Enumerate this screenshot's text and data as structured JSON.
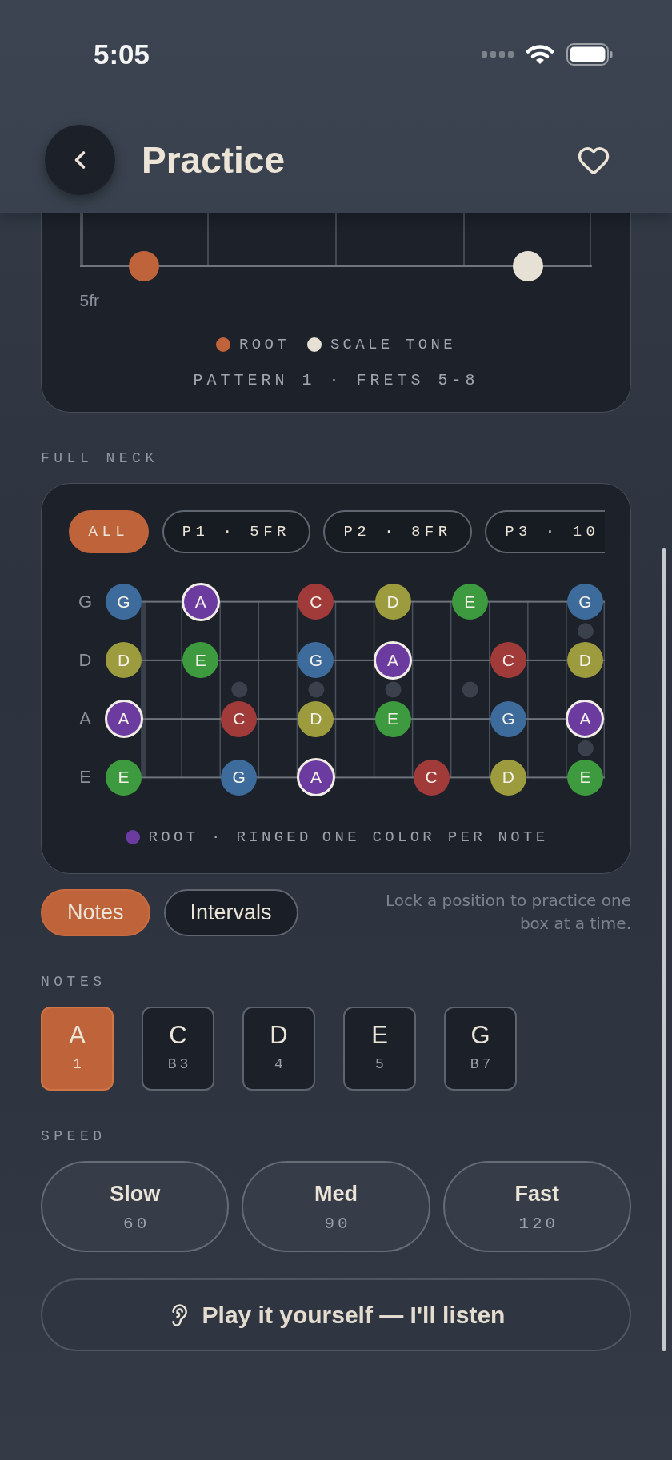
{
  "status_bar": {
    "time": "5:05"
  },
  "header": {
    "title": "Practice",
    "favorite": false
  },
  "pattern_card": {
    "slots": [
      {
        "kind": "root"
      },
      {
        "kind": "empty"
      },
      {
        "kind": "empty"
      },
      {
        "kind": "scale_tone"
      }
    ],
    "fret_label": "5fr",
    "legend": [
      {
        "kind": "root",
        "label": "ROOT"
      },
      {
        "kind": "scale_tone",
        "label": "SCALE TONE"
      }
    ],
    "caption": "PATTERN 1 · FRETS 5-8"
  },
  "full_neck": {
    "heading": "FULL NECK",
    "positions": [
      {
        "label": "ALL",
        "selected": true
      },
      {
        "label": "P1 · 5FR",
        "selected": false
      },
      {
        "label": "P2 · 8FR",
        "selected": false
      },
      {
        "label": "P3 · 10",
        "selected": false
      }
    ],
    "strings": [
      {
        "name": "G",
        "slots": [
          {
            "kind": "note",
            "label": "G",
            "color": "#3c6b9c",
            "root": false
          },
          {
            "kind": "empty"
          },
          {
            "kind": "note",
            "label": "A",
            "color": "#6b3ba0",
            "root": true
          },
          {
            "kind": "empty"
          },
          {
            "kind": "empty"
          },
          {
            "kind": "note",
            "label": "C",
            "color": "#a13b39",
            "root": false
          },
          {
            "kind": "empty"
          },
          {
            "kind": "note",
            "label": "D",
            "color": "#9c9b3d",
            "root": false
          },
          {
            "kind": "empty"
          },
          {
            "kind": "note",
            "label": "E",
            "color": "#3e9a3e",
            "root": false
          },
          {
            "kind": "empty"
          },
          {
            "kind": "empty"
          },
          {
            "kind": "note",
            "label": "G",
            "color": "#3c6b9c",
            "root": false
          }
        ]
      },
      {
        "name": "D",
        "slots": [
          {
            "kind": "note",
            "label": "D",
            "color": "#9c9b3d",
            "root": false
          },
          {
            "kind": "empty"
          },
          {
            "kind": "note",
            "label": "E",
            "color": "#3e9a3e",
            "root": false
          },
          {
            "kind": "empty"
          },
          {
            "kind": "empty"
          },
          {
            "kind": "note",
            "label": "G",
            "color": "#3c6b9c",
            "root": false
          },
          {
            "kind": "empty"
          },
          {
            "kind": "note",
            "label": "A",
            "color": "#6b3ba0",
            "root": true
          },
          {
            "kind": "empty"
          },
          {
            "kind": "empty"
          },
          {
            "kind": "note",
            "label": "C",
            "color": "#a13b39",
            "root": false
          },
          {
            "kind": "empty"
          },
          {
            "kind": "note",
            "label": "D",
            "color": "#9c9b3d",
            "root": false
          }
        ]
      },
      {
        "name": "A",
        "slots": [
          {
            "kind": "note",
            "label": "A",
            "color": "#6b3ba0",
            "root": true
          },
          {
            "kind": "empty"
          },
          {
            "kind": "empty"
          },
          {
            "kind": "note",
            "label": "C",
            "color": "#a13b39",
            "root": false
          },
          {
            "kind": "empty"
          },
          {
            "kind": "note",
            "label": "D",
            "color": "#9c9b3d",
            "root": false
          },
          {
            "kind": "empty"
          },
          {
            "kind": "note",
            "label": "E",
            "color": "#3e9a3e",
            "root": false
          },
          {
            "kind": "empty"
          },
          {
            "kind": "empty"
          },
          {
            "kind": "note",
            "label": "G",
            "color": "#3c6b9c",
            "root": false
          },
          {
            "kind": "empty"
          },
          {
            "kind": "note",
            "label": "A",
            "color": "#6b3ba0",
            "root": true
          }
        ]
      },
      {
        "name": "E",
        "slots": [
          {
            "kind": "note",
            "label": "E",
            "color": "#3e9a3e",
            "root": false
          },
          {
            "kind": "empty"
          },
          {
            "kind": "empty"
          },
          {
            "kind": "note",
            "label": "G",
            "color": "#3c6b9c",
            "root": false
          },
          {
            "kind": "empty"
          },
          {
            "kind": "note",
            "label": "A",
            "color": "#6b3ba0",
            "root": true
          },
          {
            "kind": "empty"
          },
          {
            "kind": "empty"
          },
          {
            "kind": "note",
            "label": "C",
            "color": "#a13b39",
            "root": false
          },
          {
            "kind": "empty"
          },
          {
            "kind": "note",
            "label": "D",
            "color": "#9c9b3d",
            "root": false
          },
          {
            "kind": "empty"
          },
          {
            "kind": "note",
            "label": "E",
            "color": "#3e9a3e",
            "root": false
          }
        ]
      }
    ],
    "legend": {
      "color": "#6b3ba0",
      "label": "ROOT · RINGED",
      "note": "ONE COLOR PER NOTE"
    }
  },
  "display_modes": [
    {
      "label": "Notes",
      "selected": true
    },
    {
      "label": "Intervals",
      "selected": false
    }
  ],
  "hint": "Lock a position to practice one box at a time.",
  "notes": {
    "heading": "NOTES",
    "items": [
      {
        "note": "A",
        "interval": "1",
        "selected": true
      },
      {
        "note": "C",
        "interval": "B3",
        "selected": false
      },
      {
        "note": "D",
        "interval": "4",
        "selected": false
      },
      {
        "note": "E",
        "interval": "5",
        "selected": false
      },
      {
        "note": "G",
        "interval": "B7",
        "selected": false
      }
    ]
  },
  "speed": {
    "heading": "SPEED",
    "options": [
      {
        "label": "Slow",
        "bpm": "60"
      },
      {
        "label": "Med",
        "bpm": "90"
      },
      {
        "label": "Fast",
        "bpm": "120"
      }
    ]
  },
  "listen_button": {
    "label": "Play it yourself — I'll listen"
  }
}
